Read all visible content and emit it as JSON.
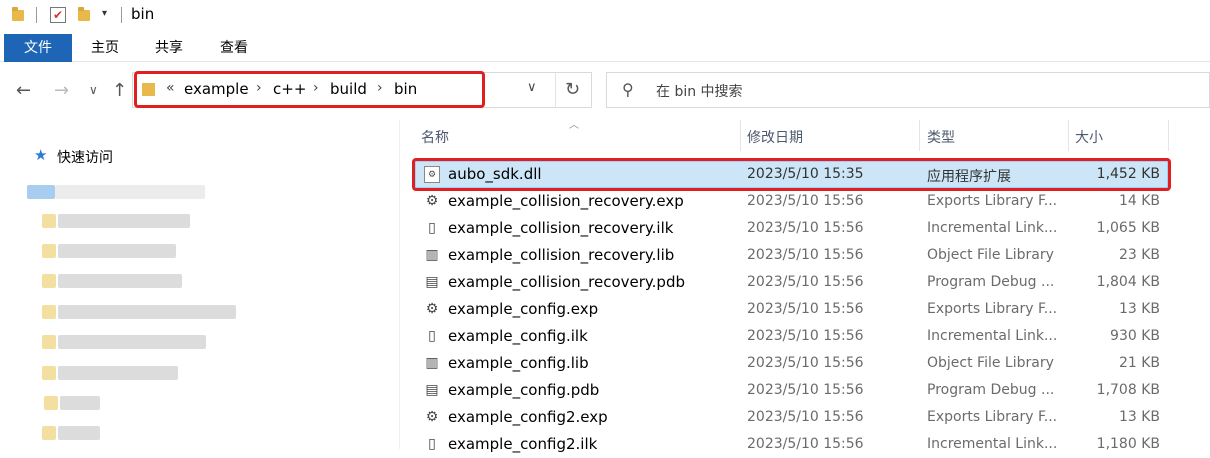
{
  "window": {
    "title": "bin"
  },
  "ribbon": {
    "tabs": [
      "文件",
      "主页",
      "共享",
      "查看"
    ]
  },
  "address": {
    "breadcrumb_overflow": "«",
    "crumbs": [
      "example",
      "c++",
      "build",
      "bin"
    ]
  },
  "search": {
    "placeholder": "在 bin 中搜索"
  },
  "nav": {
    "quick_access": "快速访问"
  },
  "columns": {
    "name": "名称",
    "date": "修改日期",
    "type": "类型",
    "size": "大小"
  },
  "files": [
    {
      "name": "aubo_sdk.dll",
      "date": "2023/5/10 15:35",
      "type": "应用程序扩展",
      "size": "1,452 KB",
      "icon": "dll-icon",
      "selected": true
    },
    {
      "name": "example_collision_recovery.exp",
      "date": "2023/5/10 15:56",
      "type": "Exports Library F...",
      "size": "14 KB",
      "icon": "exp-icon"
    },
    {
      "name": "example_collision_recovery.ilk",
      "date": "2023/5/10 15:56",
      "type": "Incremental Link...",
      "size": "1,065 KB",
      "icon": "ilk-icon"
    },
    {
      "name": "example_collision_recovery.lib",
      "date": "2023/5/10 15:56",
      "type": "Object File Library",
      "size": "23 KB",
      "icon": "lib-icon"
    },
    {
      "name": "example_collision_recovery.pdb",
      "date": "2023/5/10 15:56",
      "type": "Program Debug ...",
      "size": "1,804 KB",
      "icon": "pdb-icon"
    },
    {
      "name": "example_config.exp",
      "date": "2023/5/10 15:56",
      "type": "Exports Library F...",
      "size": "13 KB",
      "icon": "exp-icon"
    },
    {
      "name": "example_config.ilk",
      "date": "2023/5/10 15:56",
      "type": "Incremental Link...",
      "size": "930 KB",
      "icon": "ilk-icon"
    },
    {
      "name": "example_config.lib",
      "date": "2023/5/10 15:56",
      "type": "Object File Library",
      "size": "21 KB",
      "icon": "lib-icon"
    },
    {
      "name": "example_config.pdb",
      "date": "2023/5/10 15:56",
      "type": "Program Debug ...",
      "size": "1,708 KB",
      "icon": "pdb-icon"
    },
    {
      "name": "example_config2.exp",
      "date": "2023/5/10 15:56",
      "type": "Exports Library F...",
      "size": "13 KB",
      "icon": "exp-icon"
    },
    {
      "name": "example_config2.ilk",
      "date": "2023/5/10 15:56",
      "type": "Incremental Link...",
      "size": "1,180 KB",
      "icon": "ilk-icon"
    }
  ]
}
